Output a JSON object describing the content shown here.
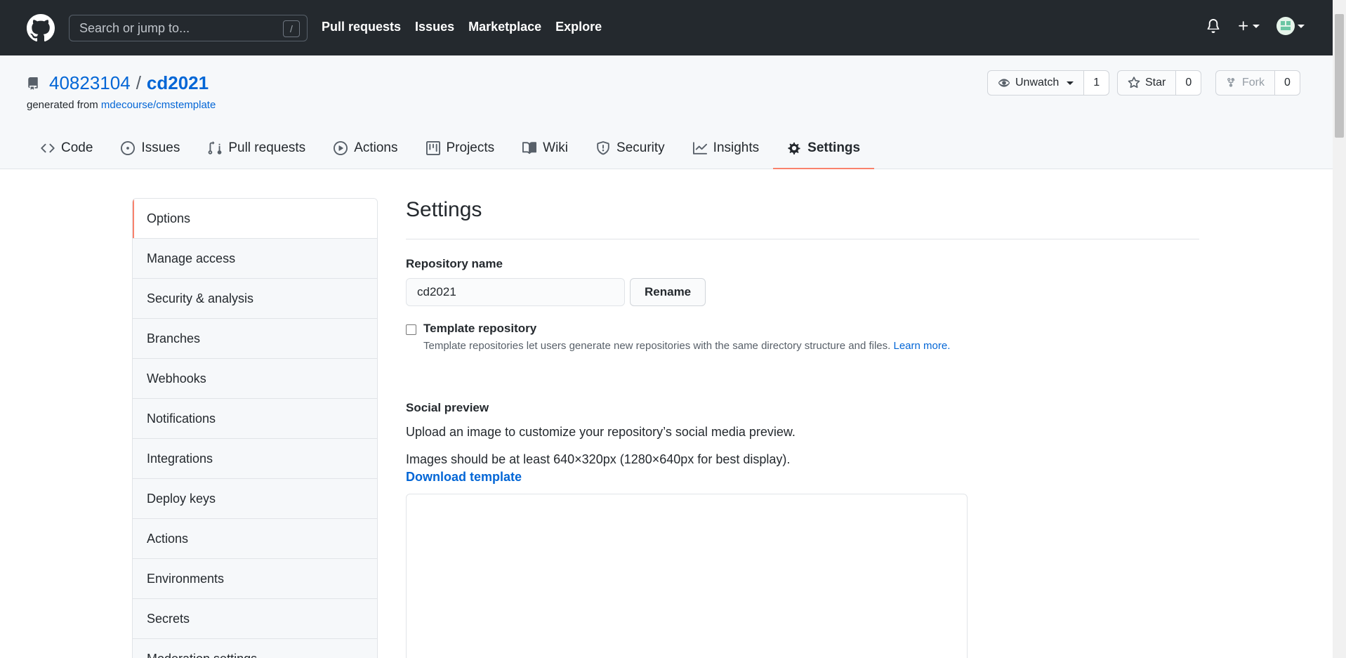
{
  "header": {
    "search_placeholder": "Search or jump to...",
    "search_key": "/",
    "nav": [
      "Pull requests",
      "Issues",
      "Marketplace",
      "Explore"
    ]
  },
  "repo": {
    "owner": "40823104",
    "separator": "/",
    "name": "cd2021",
    "generated_prefix": "generated from ",
    "template_link": "mdecourse/cmstemplate",
    "watch": {
      "label": "Unwatch",
      "count": "1"
    },
    "star": {
      "label": "Star",
      "count": "0"
    },
    "fork": {
      "label": "Fork",
      "count": "0"
    }
  },
  "tabs": [
    {
      "label": "Code",
      "icon": "code-icon"
    },
    {
      "label": "Issues",
      "icon": "issue-icon"
    },
    {
      "label": "Pull requests",
      "icon": "pull-request-icon"
    },
    {
      "label": "Actions",
      "icon": "play-icon"
    },
    {
      "label": "Projects",
      "icon": "project-icon"
    },
    {
      "label": "Wiki",
      "icon": "book-icon"
    },
    {
      "label": "Security",
      "icon": "shield-icon"
    },
    {
      "label": "Insights",
      "icon": "graph-icon"
    },
    {
      "label": "Settings",
      "icon": "gear-icon"
    }
  ],
  "sidebar": {
    "items": [
      {
        "label": "Options"
      },
      {
        "label": "Manage access"
      },
      {
        "label": "Security & analysis"
      },
      {
        "label": "Branches"
      },
      {
        "label": "Webhooks"
      },
      {
        "label": "Notifications"
      },
      {
        "label": "Integrations"
      },
      {
        "label": "Deploy keys"
      },
      {
        "label": "Actions"
      },
      {
        "label": "Environments"
      },
      {
        "label": "Secrets"
      },
      {
        "label": "Moderation settings"
      }
    ]
  },
  "main": {
    "title": "Settings",
    "repo_name_label": "Repository name",
    "repo_name_value": "cd2021",
    "rename_label": "Rename",
    "template_label": "Template repository",
    "template_note": "Template repositories let users generate new repositories with the same directory structure and files. ",
    "learn_more": "Learn more.",
    "social_label": "Social preview",
    "social_text1": "Upload an image to customize your repository’s social media preview.",
    "social_text2": "Images should be at least 640×320px (1280×640px for best display).",
    "download_template": "Download template"
  },
  "colors": {
    "header_bg": "#24292e",
    "link": "#0366d6",
    "active_accent": "#f9826c"
  }
}
